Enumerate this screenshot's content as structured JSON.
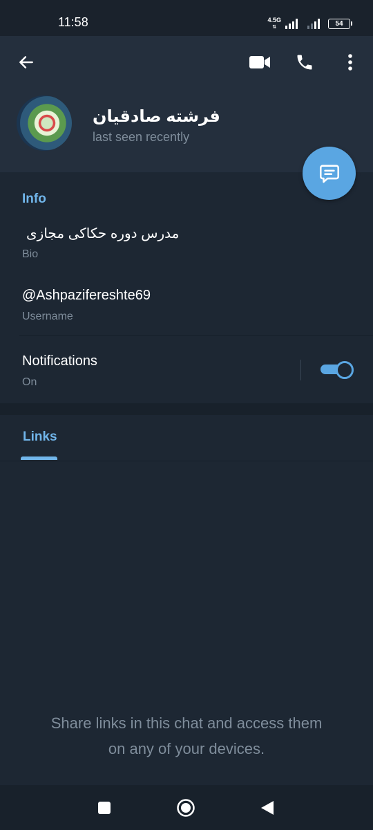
{
  "status_bar": {
    "time": "11:58",
    "network": "4.5G",
    "battery": "54"
  },
  "header": {
    "name": "فرشته صادقیان",
    "last_seen": "last seen recently"
  },
  "info": {
    "title": "Info",
    "bio_value": "مدرس دوره حکاکی  مجازی",
    "bio_label": "Bio",
    "username_value": "@Ashpazifereshte69",
    "username_label": "Username",
    "notifications_value": "Notifications",
    "notifications_label": "On",
    "notifications_enabled": true
  },
  "tabs": {
    "links": "Links"
  },
  "empty_state": {
    "line1": "Share links in this chat and access them",
    "line2": "on any of your devices."
  },
  "colors": {
    "accent": "#71b6eb",
    "fab": "#5aa6e2",
    "background": "#1d2733",
    "header": "#242f3d"
  },
  "icons": {
    "back": "arrow-left-icon",
    "video": "video-camera-icon",
    "call": "phone-icon",
    "more": "more-vertical-icon",
    "message": "message-icon"
  }
}
